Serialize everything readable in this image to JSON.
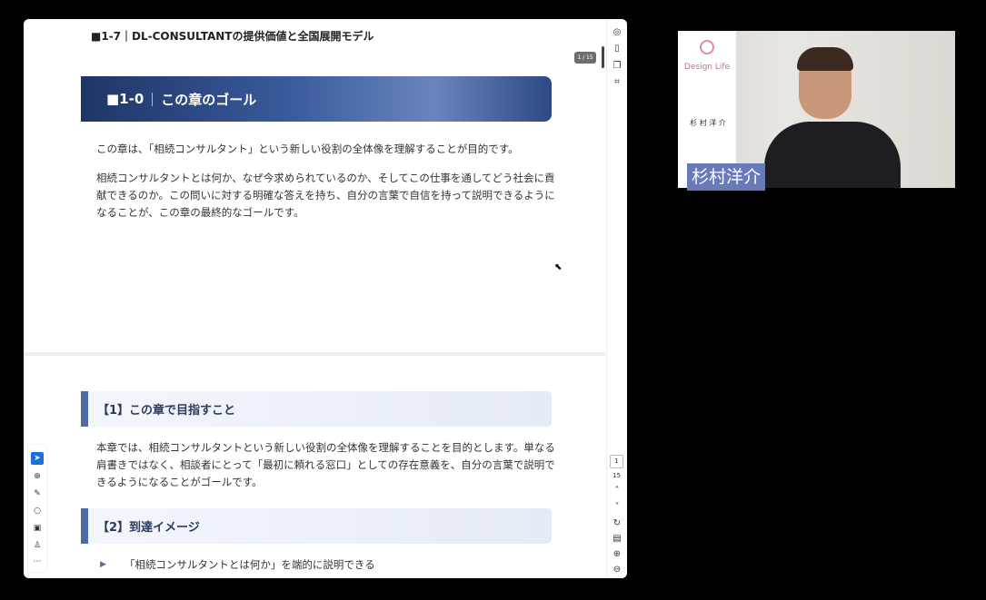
{
  "document": {
    "title": "■1-7｜DL-CONSULTANTの提供価値と全国展開モデル"
  },
  "page1": {
    "banner": {
      "number": "■1-0",
      "text": "この章のゴール"
    },
    "paragraph1": "この章は、「相続コンサルタント」という新しい役割の全体像を理解することが目的です。",
    "paragraph2": "相続コンサルタントとは何か、なぜ今求められているのか、そしてこの仕事を通してどう社会に貢献できるのか。この問いに対する明確な答えを持ち、自分の言葉で自信を持って説明できるようになることが、この章の最終的なゴールです。"
  },
  "page2": {
    "section1": {
      "heading": "【1】この章で目指すこと",
      "text": "本章では、相続コンサルタントという新しい役割の全体像を理解することを目的とします。単なる肩書きではなく、相談者にとって「最初に頼れる窓口」としての存在意義を、自分の言葉で説明できるようになることがゴールです。"
    },
    "section2": {
      "heading": "【2】到達イメージ",
      "bullets": [
        "「相続コンサルタントとは何か」を端的に説明できる"
      ]
    }
  },
  "viewer": {
    "page_indicator": "1 / 15",
    "current_page": "1",
    "total_pages": "15",
    "right_toolbar_icons": [
      "reader-icon",
      "read-aloud-icon",
      "copy-icon",
      "crop-icon"
    ],
    "nav_icons": [
      "chevron-up-icon",
      "chevron-down-icon",
      "rotate-icon",
      "page-fit-icon",
      "zoom-in-icon",
      "zoom-out-icon"
    ],
    "left_tools": [
      "select-icon",
      "find-icon",
      "pen-icon",
      "lasso-icon",
      "image-icon",
      "stamp-icon",
      "more-icon"
    ]
  },
  "video": {
    "brand": "Design Life",
    "speaker_name": "杉村洋介",
    "card_name": "杉 村 洋 介"
  }
}
